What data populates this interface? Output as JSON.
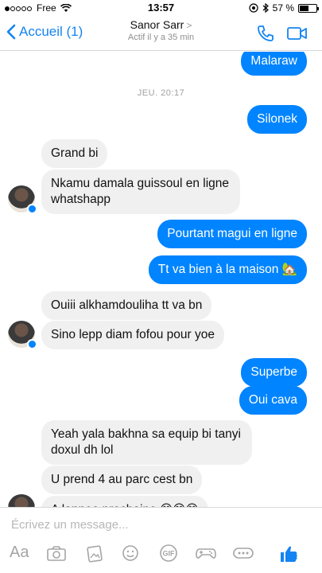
{
  "status_bar": {
    "carrier": "Free",
    "time": "13:57",
    "battery": "57 %",
    "battery_level": 0.57
  },
  "header": {
    "back_label": "Accueil (1)",
    "contact_name": "Sanor Sarr",
    "contact_status": "Actif il y a 35 min",
    "icons": [
      "phone-icon",
      "video-icon"
    ],
    "accent": "#1484f2"
  },
  "conversation": {
    "timestamp": "JEU. 20:17",
    "messages": [
      {
        "from": "me",
        "text": "Malaraw"
      },
      {
        "from": "me",
        "text": "Silonek"
      },
      {
        "from": "contact",
        "text": "Grand bi"
      },
      {
        "from": "contact",
        "text": "Nkamu damala guissoul en ligne whatshapp"
      },
      {
        "from": "me",
        "text": "Pourtant magui en ligne"
      },
      {
        "from": "me",
        "text": "Tt va bien à la maison 🏡"
      },
      {
        "from": "contact",
        "text": "Ouiii alkhamdouliha tt va bn"
      },
      {
        "from": "contact",
        "text": "Sino lepp diam fofou pour yoe"
      },
      {
        "from": "me",
        "text": "Superbe"
      },
      {
        "from": "me",
        "text": "Oui cava"
      },
      {
        "from": "contact",
        "text": "Yeah yala bakhna sa equip bi tanyi doxul dh lol"
      },
      {
        "from": "contact",
        "text": "U prend 4 au parc cest bn"
      },
      {
        "from": "contact",
        "text": "A lannee prochaine 😊😊😊"
      }
    ],
    "colors": {
      "outgoing": "#0084ff",
      "incoming": "#f1f0f0"
    }
  },
  "composer": {
    "placeholder": "Écrivez un message...",
    "aa_label": "Aa",
    "tools": [
      "camera-icon",
      "gallery-icon",
      "emoji-icon",
      "gif-icon",
      "game-icon",
      "more-icon",
      "like-icon"
    ]
  }
}
